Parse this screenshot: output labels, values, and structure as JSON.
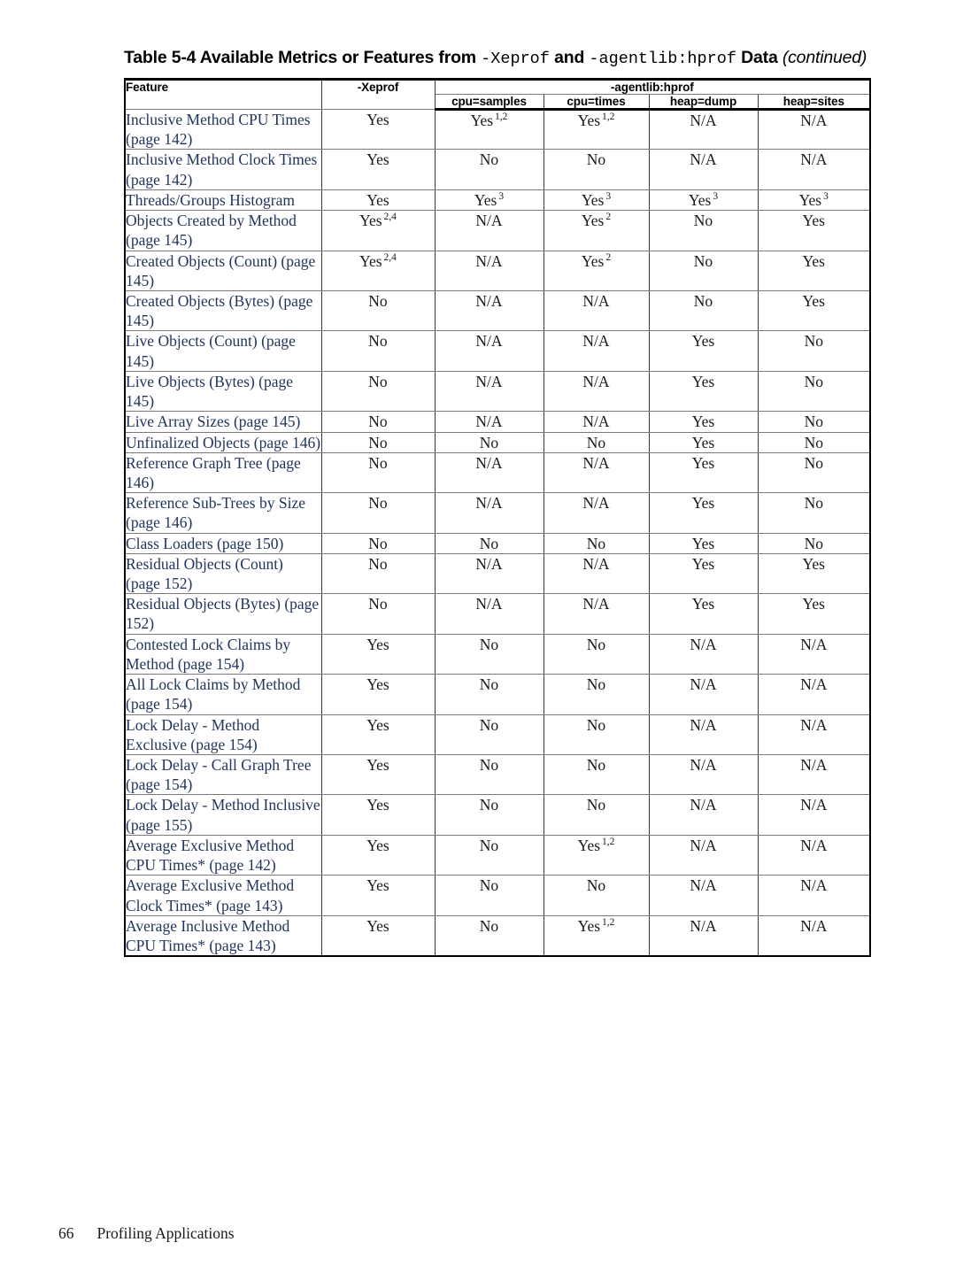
{
  "title": {
    "prefix": "Table 5-4 Available Metrics or Features from ",
    "mono1": "-Xeprof",
    "mid": " and ",
    "mono2": "-agentlib:hprof",
    "suffix": " Data ",
    "continued": "(continued)"
  },
  "table": {
    "headers": {
      "feature": "Feature",
      "xeprof": "-Xeprof",
      "group": "-agentlib:hprof",
      "sub": [
        "cpu=samples",
        "cpu=times",
        "heap=dump",
        "heap=sites"
      ]
    },
    "rows": [
      {
        "feature": "Inclusive Method CPU Times (page 142)",
        "values": [
          {
            "text": "Yes",
            "sup": ""
          },
          {
            "text": "Yes",
            "sup": "1,2"
          },
          {
            "text": "Yes",
            "sup": "1,2"
          },
          {
            "text": "N/A",
            "sup": ""
          },
          {
            "text": "N/A",
            "sup": ""
          }
        ]
      },
      {
        "feature": "Inclusive Method Clock Times (page 142)",
        "values": [
          {
            "text": "Yes",
            "sup": ""
          },
          {
            "text": "No",
            "sup": ""
          },
          {
            "text": "No",
            "sup": ""
          },
          {
            "text": "N/A",
            "sup": ""
          },
          {
            "text": "N/A",
            "sup": ""
          }
        ]
      },
      {
        "feature": "Threads/Groups Histogram",
        "values": [
          {
            "text": "Yes",
            "sup": ""
          },
          {
            "text": "Yes",
            "sup": "3"
          },
          {
            "text": "Yes",
            "sup": "3"
          },
          {
            "text": "Yes",
            "sup": "3"
          },
          {
            "text": "Yes",
            "sup": "3"
          }
        ]
      },
      {
        "feature": "Objects Created by Method (page 145)",
        "values": [
          {
            "text": "Yes",
            "sup": "2,4"
          },
          {
            "text": "N/A",
            "sup": ""
          },
          {
            "text": "Yes",
            "sup": "2"
          },
          {
            "text": "No",
            "sup": ""
          },
          {
            "text": "Yes",
            "sup": ""
          }
        ]
      },
      {
        "feature": "Created Objects (Count) (page 145)",
        "values": [
          {
            "text": "Yes",
            "sup": "2,4"
          },
          {
            "text": "N/A",
            "sup": ""
          },
          {
            "text": "Yes",
            "sup": "2"
          },
          {
            "text": "No",
            "sup": ""
          },
          {
            "text": "Yes",
            "sup": ""
          }
        ]
      },
      {
        "feature": "Created Objects (Bytes) (page 145)",
        "values": [
          {
            "text": "No",
            "sup": ""
          },
          {
            "text": "N/A",
            "sup": ""
          },
          {
            "text": "N/A",
            "sup": ""
          },
          {
            "text": "No",
            "sup": ""
          },
          {
            "text": "Yes",
            "sup": ""
          }
        ]
      },
      {
        "feature": "Live Objects (Count) (page 145)",
        "values": [
          {
            "text": "No",
            "sup": ""
          },
          {
            "text": "N/A",
            "sup": ""
          },
          {
            "text": "N/A",
            "sup": ""
          },
          {
            "text": "Yes",
            "sup": ""
          },
          {
            "text": "No",
            "sup": ""
          }
        ]
      },
      {
        "feature": "Live Objects (Bytes) (page 145)",
        "values": [
          {
            "text": "No",
            "sup": ""
          },
          {
            "text": "N/A",
            "sup": ""
          },
          {
            "text": "N/A",
            "sup": ""
          },
          {
            "text": "Yes",
            "sup": ""
          },
          {
            "text": "No",
            "sup": ""
          }
        ]
      },
      {
        "feature": "Live Array Sizes (page 145)",
        "values": [
          {
            "text": "No",
            "sup": ""
          },
          {
            "text": "N/A",
            "sup": ""
          },
          {
            "text": "N/A",
            "sup": ""
          },
          {
            "text": "Yes",
            "sup": ""
          },
          {
            "text": "No",
            "sup": ""
          }
        ]
      },
      {
        "feature": "Unfinalized Objects (page 146)",
        "values": [
          {
            "text": "No",
            "sup": ""
          },
          {
            "text": "No",
            "sup": ""
          },
          {
            "text": "No",
            "sup": ""
          },
          {
            "text": "Yes",
            "sup": ""
          },
          {
            "text": "No",
            "sup": ""
          }
        ]
      },
      {
        "feature": "Reference Graph Tree (page 146)",
        "values": [
          {
            "text": "No",
            "sup": ""
          },
          {
            "text": "N/A",
            "sup": ""
          },
          {
            "text": "N/A",
            "sup": ""
          },
          {
            "text": "Yes",
            "sup": ""
          },
          {
            "text": "No",
            "sup": ""
          }
        ]
      },
      {
        "feature": "Reference Sub-Trees by Size (page 146)",
        "values": [
          {
            "text": "No",
            "sup": ""
          },
          {
            "text": "N/A",
            "sup": ""
          },
          {
            "text": "N/A",
            "sup": ""
          },
          {
            "text": "Yes",
            "sup": ""
          },
          {
            "text": "No",
            "sup": ""
          }
        ]
      },
      {
        "feature": "Class Loaders (page 150)",
        "values": [
          {
            "text": "No",
            "sup": ""
          },
          {
            "text": "No",
            "sup": ""
          },
          {
            "text": "No",
            "sup": ""
          },
          {
            "text": "Yes",
            "sup": ""
          },
          {
            "text": "No",
            "sup": ""
          }
        ]
      },
      {
        "feature": "Residual Objects (Count) (page 152)",
        "values": [
          {
            "text": "No",
            "sup": ""
          },
          {
            "text": "N/A",
            "sup": ""
          },
          {
            "text": "N/A",
            "sup": ""
          },
          {
            "text": "Yes",
            "sup": ""
          },
          {
            "text": "Yes",
            "sup": ""
          }
        ]
      },
      {
        "feature": "Residual Objects (Bytes) (page 152)",
        "values": [
          {
            "text": "No",
            "sup": ""
          },
          {
            "text": "N/A",
            "sup": ""
          },
          {
            "text": "N/A",
            "sup": ""
          },
          {
            "text": "Yes",
            "sup": ""
          },
          {
            "text": "Yes",
            "sup": ""
          }
        ]
      },
      {
        "feature": "Contested Lock Claims by Method (page 154)",
        "values": [
          {
            "text": "Yes",
            "sup": ""
          },
          {
            "text": "No",
            "sup": ""
          },
          {
            "text": "No",
            "sup": ""
          },
          {
            "text": "N/A",
            "sup": ""
          },
          {
            "text": "N/A",
            "sup": ""
          }
        ]
      },
      {
        "feature": "All Lock Claims by Method (page 154)",
        "values": [
          {
            "text": "Yes",
            "sup": ""
          },
          {
            "text": "No",
            "sup": ""
          },
          {
            "text": "No",
            "sup": ""
          },
          {
            "text": "N/A",
            "sup": ""
          },
          {
            "text": "N/A",
            "sup": ""
          }
        ]
      },
      {
        "feature": "Lock Delay - Method Exclusive (page 154)",
        "values": [
          {
            "text": "Yes",
            "sup": ""
          },
          {
            "text": "No",
            "sup": ""
          },
          {
            "text": "No",
            "sup": ""
          },
          {
            "text": "N/A",
            "sup": ""
          },
          {
            "text": "N/A",
            "sup": ""
          }
        ]
      },
      {
        "feature": "Lock Delay - Call Graph Tree (page 154)",
        "values": [
          {
            "text": "Yes",
            "sup": ""
          },
          {
            "text": "No",
            "sup": ""
          },
          {
            "text": "No",
            "sup": ""
          },
          {
            "text": "N/A",
            "sup": ""
          },
          {
            "text": "N/A",
            "sup": ""
          }
        ]
      },
      {
        "feature": "Lock Delay - Method Inclusive (page 155)",
        "values": [
          {
            "text": "Yes",
            "sup": ""
          },
          {
            "text": "No",
            "sup": ""
          },
          {
            "text": "No",
            "sup": ""
          },
          {
            "text": "N/A",
            "sup": ""
          },
          {
            "text": "N/A",
            "sup": ""
          }
        ]
      },
      {
        "feature": "Average Exclusive Method CPU Times* (page 142)",
        "values": [
          {
            "text": "Yes",
            "sup": ""
          },
          {
            "text": "No",
            "sup": ""
          },
          {
            "text": "Yes",
            "sup": "1,2"
          },
          {
            "text": "N/A",
            "sup": ""
          },
          {
            "text": "N/A",
            "sup": ""
          }
        ]
      },
      {
        "feature": "Average Exclusive Method Clock Times* (page 143)",
        "values": [
          {
            "text": "Yes",
            "sup": ""
          },
          {
            "text": "No",
            "sup": ""
          },
          {
            "text": "No",
            "sup": ""
          },
          {
            "text": "N/A",
            "sup": ""
          },
          {
            "text": "N/A",
            "sup": ""
          }
        ]
      },
      {
        "feature": "Average Inclusive Method CPU Times* (page 143)",
        "values": [
          {
            "text": "Yes",
            "sup": ""
          },
          {
            "text": "No",
            "sup": ""
          },
          {
            "text": "Yes",
            "sup": "1,2"
          },
          {
            "text": "N/A",
            "sup": ""
          },
          {
            "text": "N/A",
            "sup": ""
          }
        ]
      }
    ]
  },
  "footer": {
    "page_number": "66",
    "chapter": "Profiling Applications"
  },
  "colors": {
    "feature_text": "#21355c",
    "value_text": "#1a1a1a",
    "border_heavy": "#000000",
    "border_light": "#7a7a7a"
  }
}
